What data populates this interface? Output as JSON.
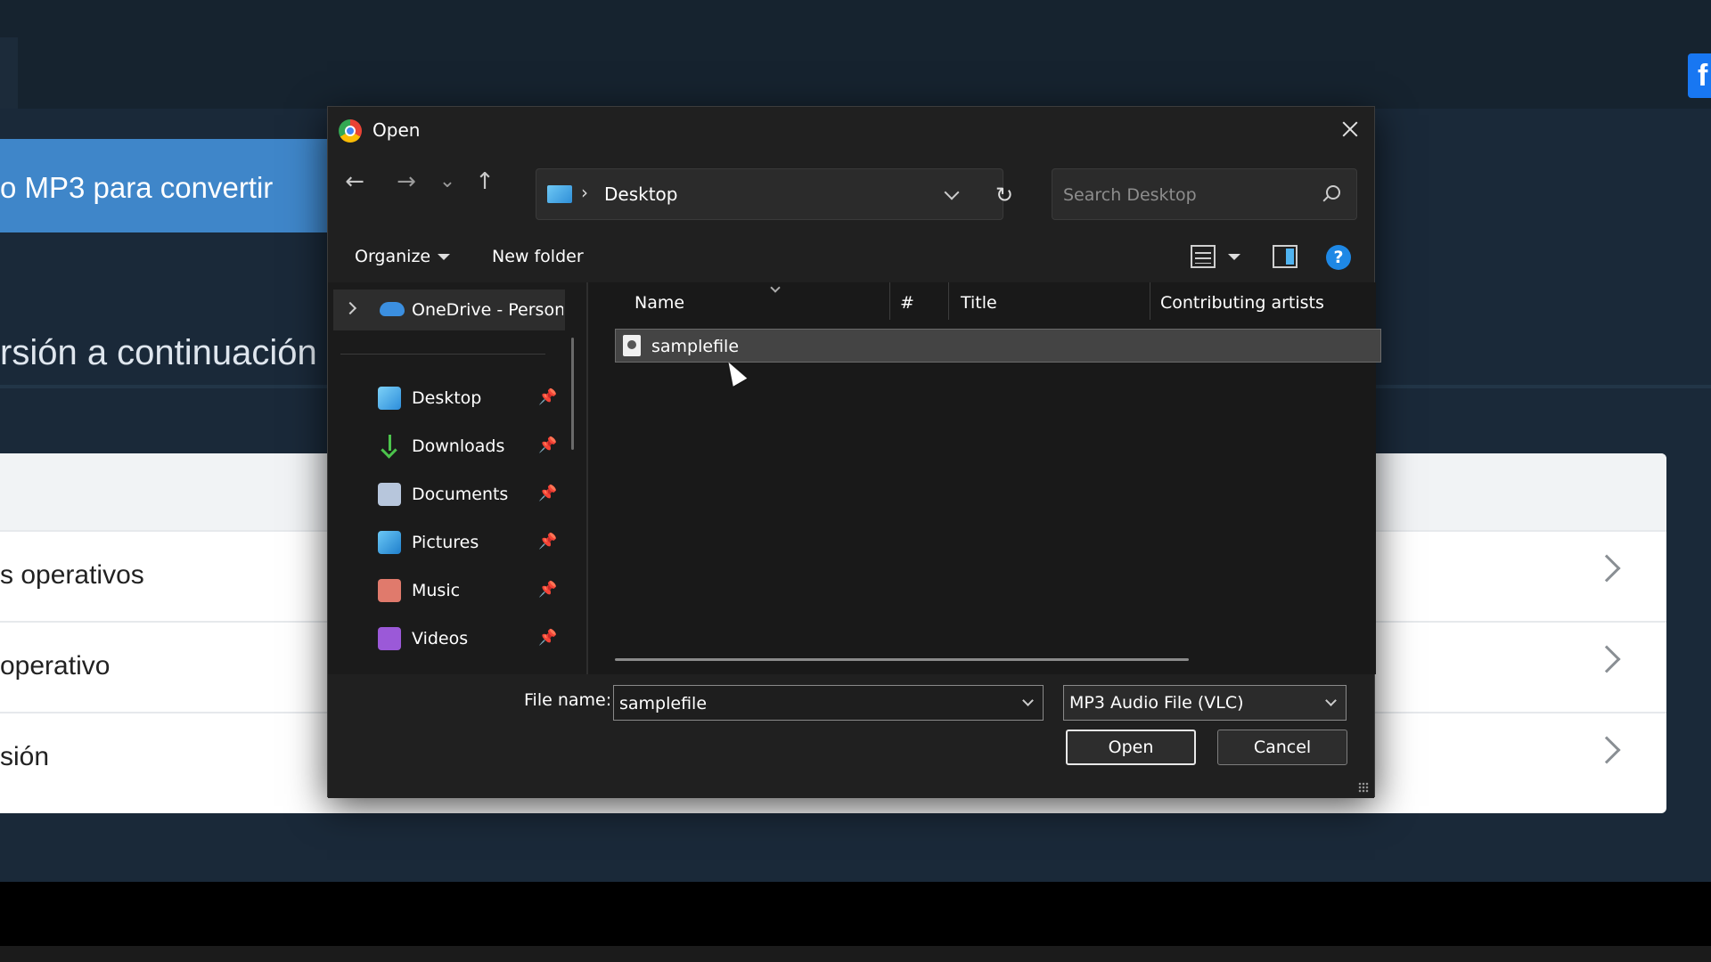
{
  "background": {
    "banner_text": "o MP3 para convertir",
    "heading_text": "rsión a continuación",
    "rows": [
      {
        "label": "s operativos"
      },
      {
        "label": "operativo"
      },
      {
        "label": "sión"
      }
    ],
    "fb_icon": "f"
  },
  "dialog": {
    "title": "Open",
    "app_icon": "chrome-icon",
    "nav": {
      "back_icon": "←",
      "forward_icon": "→",
      "recent_icon": "⌄",
      "up_icon": "↑"
    },
    "address": {
      "separator": "›",
      "location": "Desktop",
      "refresh_icon": "↻"
    },
    "search": {
      "placeholder": "Search Desktop"
    },
    "toolbar": {
      "organize_label": "Organize",
      "new_folder_label": "New folder",
      "help_label": "?"
    },
    "nav_pane": {
      "onedrive_label": "OneDrive - Personal",
      "quick_access": [
        {
          "label": "Desktop",
          "icon": "desktop-icon"
        },
        {
          "label": "Downloads",
          "icon": "downloads-icon"
        },
        {
          "label": "Documents",
          "icon": "documents-icon"
        },
        {
          "label": "Pictures",
          "icon": "pictures-icon"
        },
        {
          "label": "Music",
          "icon": "music-icon"
        },
        {
          "label": "Videos",
          "icon": "videos-icon"
        }
      ],
      "pin_icon": "📌"
    },
    "columns": [
      "Name",
      "#",
      "Title",
      "Contributing artists"
    ],
    "files": [
      {
        "name": "samplefile",
        "selected": true
      }
    ],
    "file_name_label": "File name:",
    "file_name_value": "samplefile",
    "file_type_value": "MP3 Audio File (VLC)",
    "open_label": "Open",
    "cancel_label": "Cancel"
  }
}
